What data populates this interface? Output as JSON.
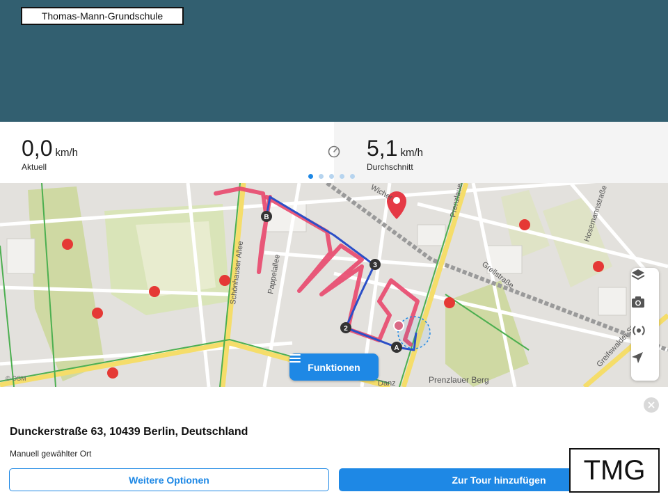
{
  "header": {
    "school_label": "Thomas-Mann-Grundschule"
  },
  "stats": {
    "current": {
      "value": "0,0",
      "unit": "km/h",
      "label": "Aktuell"
    },
    "average": {
      "value": "5,1",
      "unit": "km/h",
      "label": "Durchschnitt"
    },
    "pager": {
      "count": 5,
      "active_index": 0
    }
  },
  "map": {
    "street_labels": [
      "Schönhauser Allee",
      "Pappelallee",
      "Grellstraße",
      "Prenzlauer",
      "Hosemannstraße",
      "Greifswalder Str",
      "Prenzlauer Berg",
      "Danz",
      "Wicher"
    ],
    "route_markers": [
      "A",
      "B",
      "2",
      "3"
    ],
    "attribution": "© OSM",
    "functions_button": "Funktionen",
    "tools": [
      "layers-icon",
      "camera-icon",
      "radar-icon",
      "locate-icon"
    ]
  },
  "panel": {
    "address": "Dunckerstraße 63, 10439 Berlin, Deutschland",
    "subtitle": "Manuell gewählter Ort",
    "more_options": "Weitere Optionen",
    "add_to_tour": "Zur Tour hinzufügen",
    "tmg_stamp": "TMG"
  },
  "colors": {
    "header": "#325f70",
    "accent": "#1e88e5",
    "route": "#e8486d",
    "path": "#2b4fc7"
  }
}
